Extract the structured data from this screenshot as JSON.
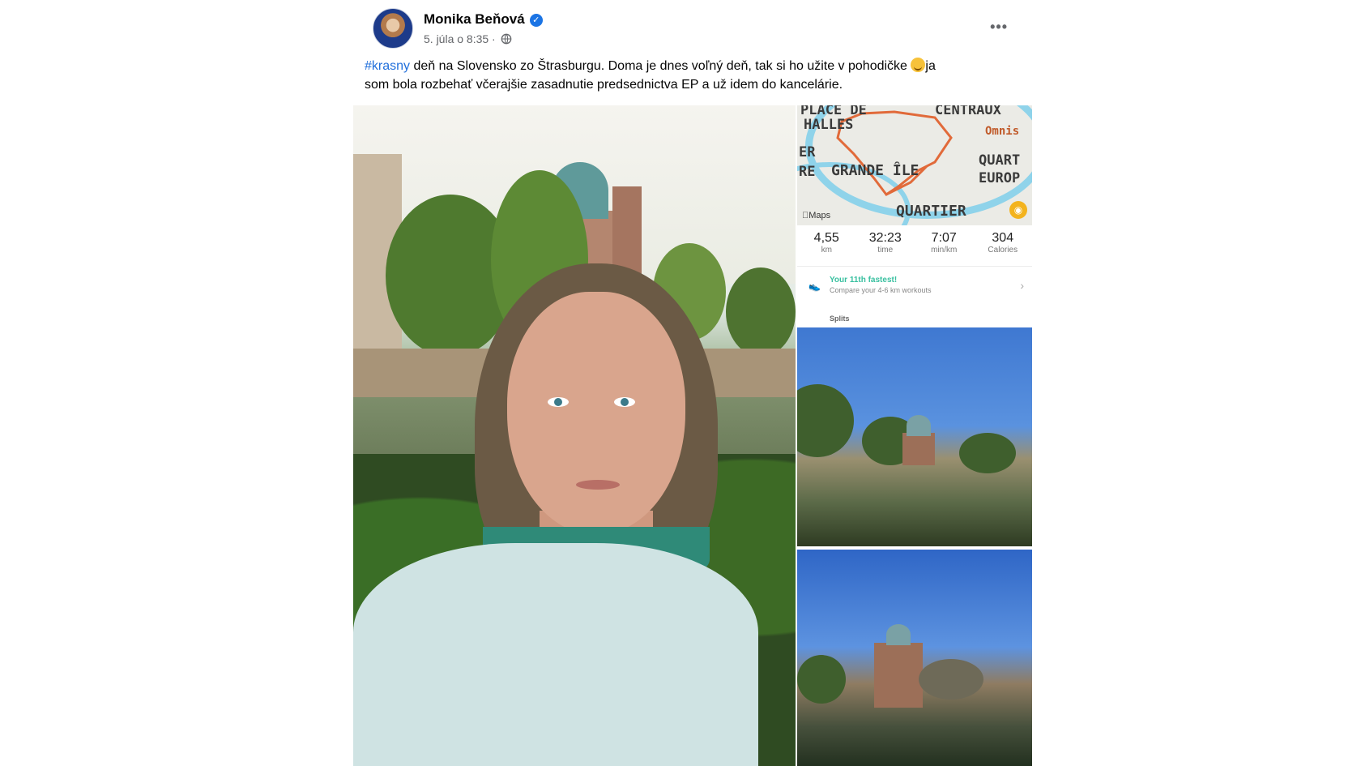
{
  "post": {
    "author": "Monika Beňová",
    "meta": "5. júla o 8:35 ·",
    "more_label": "•••",
    "text": {
      "hashtag": "#krasny",
      "line1_rest": " deň na Slovensko zo Štrasburgu. Doma je dnes voľný deň, tak si ho užite v pohodičke ",
      "line1_end": "ja",
      "line2": "som bola  rozbehať včerajšie zasadnutie predsednictva EP a už idem do kancelárie."
    }
  },
  "icons": {
    "verified": "verified-badge-icon",
    "globe": "globe-icon",
    "emoji": "smiling-face-emoji",
    "camera": "camera-icon",
    "shoe": "running-shoe-icon",
    "chevron": "chevron-right-icon"
  },
  "map_screenshot": {
    "labels": {
      "place": "PLACE DE",
      "halles": "HALLES",
      "centraux": "CENTRAUX",
      "omnis": "Omnis",
      "er": "ER",
      "re": "RE",
      "grande_ile": "GRANDE ÎLE",
      "quart": "QUART",
      "europ": "EUROP",
      "quartier": "QUARTIER"
    },
    "maps_tag": "Maps",
    "stats": [
      {
        "value": "4,55",
        "label": "km"
      },
      {
        "value": "32:23",
        "label": "time"
      },
      {
        "value": "7:07",
        "label": "min/km"
      },
      {
        "value": "304",
        "label": "Calories"
      }
    ],
    "fastest_title": "Your 11th fastest!",
    "fastest_sub": "Compare your 4-6 km workouts",
    "splits": "Splits",
    "route_color": "#e16a3a",
    "water_color": "#8fd3ea"
  },
  "colors": {
    "hashtag": "#216fdb",
    "verified": "#1b74e4",
    "meta": "#65676b"
  }
}
